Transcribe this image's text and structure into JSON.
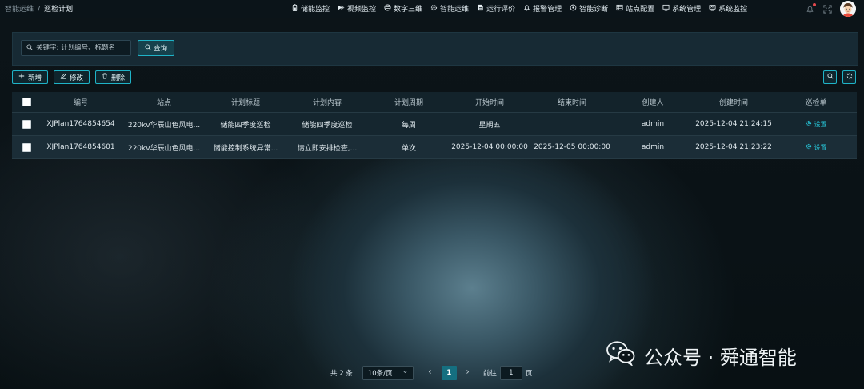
{
  "breadcrumb": {
    "root": "智能运维",
    "separator": "/",
    "current": "巡检计划"
  },
  "nav": [
    {
      "label": "储能监控",
      "icon": "battery-icon"
    },
    {
      "label": "视频监控",
      "icon": "video-icon"
    },
    {
      "label": "数字三维",
      "icon": "cube-icon"
    },
    {
      "label": "智能运维",
      "icon": "gear-icon"
    },
    {
      "label": "运行评价",
      "icon": "document-icon"
    },
    {
      "label": "报警管理",
      "icon": "bell-icon"
    },
    {
      "label": "智能诊断",
      "icon": "diagnosis-icon"
    },
    {
      "label": "站点配置",
      "icon": "table-icon"
    },
    {
      "label": "系统管理",
      "icon": "monitor-icon"
    },
    {
      "label": "系统监控",
      "icon": "screen-icon"
    }
  ],
  "search": {
    "placeholder": "关键字: 计划编号、标题名",
    "value": "",
    "button_label": "查询"
  },
  "toolbar": {
    "add_label": "新增",
    "edit_label": "修改",
    "delete_label": "删除"
  },
  "table": {
    "columns": [
      "编号",
      "站点",
      "计划标题",
      "计划内容",
      "计划周期",
      "开始时间",
      "结束时间",
      "创建人",
      "创建时间",
      "巡检单"
    ],
    "rows": [
      {
        "id": "XJPlan1764854654",
        "site": "220kv华辰山色风电...",
        "title": "储能四季度巡检",
        "content": "储能四季度巡检",
        "cycle": "每周",
        "start": "星期五",
        "end": "",
        "creator": "admin",
        "created": "2025-12-04 21:24:15",
        "action": "设置"
      },
      {
        "id": "XJPlan1764854601",
        "site": "220kv华辰山色风电...",
        "title": "储能控制系统异常...",
        "content": "请立即安排检查,...",
        "cycle": "单次",
        "start": "2025-12-04 00:00:00",
        "end": "2025-12-05 00:00:00",
        "creator": "admin",
        "created": "2025-12-04 21:23:22",
        "action": "设置"
      }
    ]
  },
  "pagination": {
    "total_text": "共 2 条",
    "page_size": "10条/页",
    "current_page": "1",
    "goto_label": "前往",
    "goto_value": "1",
    "page_unit": "页"
  },
  "watermark": {
    "text": "公众号 · 舜通智能"
  },
  "colors": {
    "accent": "#1fb3c7",
    "link": "#27c6d9",
    "active_page": "#156f80",
    "panel": "#172a34",
    "alert_dot": "#e5484d"
  }
}
